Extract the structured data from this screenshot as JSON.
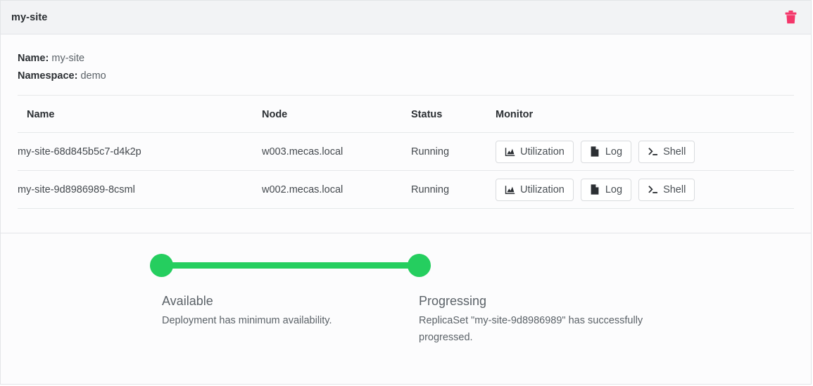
{
  "header": {
    "title": "my-site",
    "delete_icon": "trash-icon",
    "delete_color": "#f4366a"
  },
  "meta": {
    "name_label": "Name:",
    "name_value": "my-site",
    "namespace_label": "Namespace:",
    "namespace_value": "demo"
  },
  "table": {
    "columns": [
      "Name",
      "Node",
      "Status",
      "Monitor"
    ],
    "rows": [
      {
        "name": "my-site-68d845b5c7-d4k2p",
        "node": "w003.mecas.local",
        "status": "Running",
        "actions": [
          {
            "label": "Utilization",
            "icon": "area-chart-icon"
          },
          {
            "label": "Log",
            "icon": "document-icon"
          },
          {
            "label": "Shell",
            "icon": "terminal-icon"
          }
        ]
      },
      {
        "name": "my-site-9d8986989-8csml",
        "node": "w002.mecas.local",
        "status": "Running",
        "actions": [
          {
            "label": "Utilization",
            "icon": "area-chart-icon"
          },
          {
            "label": "Log",
            "icon": "document-icon"
          },
          {
            "label": "Shell",
            "icon": "terminal-icon"
          }
        ]
      }
    ]
  },
  "conditions": {
    "accent_color": "#25ce5f",
    "items": [
      {
        "title": "Available",
        "message": "Deployment has minimum availability."
      },
      {
        "title": "Progressing",
        "message": "ReplicaSet \"my-site-9d8986989\" has successfully progressed."
      }
    ]
  }
}
